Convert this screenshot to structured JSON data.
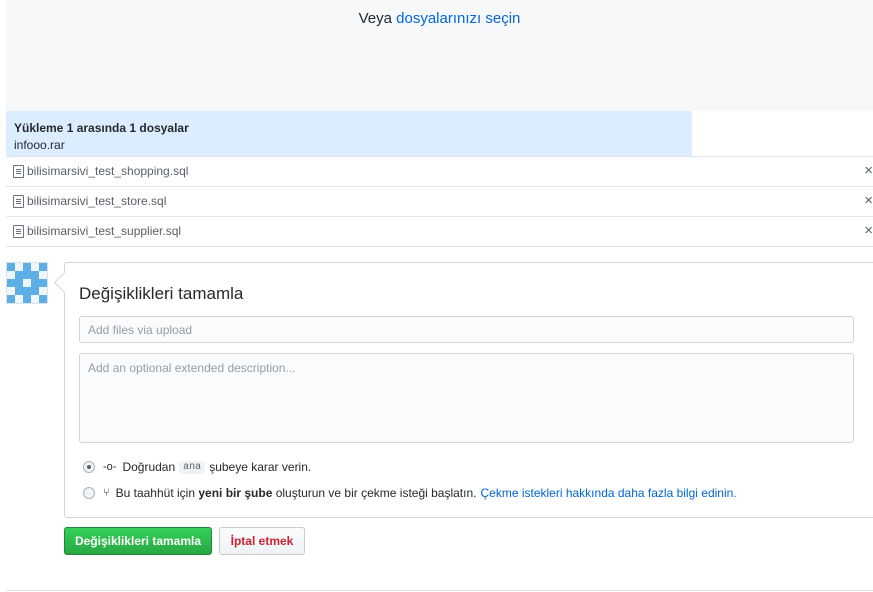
{
  "dropzone": {
    "prefix": "Veya",
    "link": "dosyalarınızı seçin"
  },
  "upload": {
    "status": "Yükleme 1 arasında 1 dosyalar",
    "filename": "infooo.rar"
  },
  "files": [
    {
      "name": "bilisimarsivi_test_shopping.sql",
      "remove_icon": "×"
    },
    {
      "name": "bilisimarsivi_test_store.sql",
      "remove_icon": "×"
    },
    {
      "name": "bilisimarsivi_test_supplier.sql",
      "remove_icon": "×"
    }
  ],
  "commit": {
    "title": "Değişiklikleri tamamla",
    "summary_placeholder": "Add files via upload",
    "description_placeholder": "Add an optional extended description...",
    "option_direct": {
      "before": "Doğrudan",
      "branch": "ana",
      "after": "şubeye karar verin.",
      "selected": true
    },
    "option_new": {
      "before": "Bu taahhüt için",
      "bold": "yeni bir şube",
      "after": "oluşturun ve bir çekme isteği başlatın.",
      "link": "Çekme istekleri hakkında daha fazla bilgi edinin.",
      "selected": false
    }
  },
  "buttons": {
    "commit": "Değişiklikleri tamamla",
    "cancel": "İptal etmek"
  },
  "colors": {
    "link": "#0366d6",
    "primary_button": "#28a745",
    "cancel_text": "#cb2431",
    "upload_bar": "#dbedff"
  },
  "icons": {
    "file": "file-text-icon",
    "remove": "close-icon",
    "commit": "git-commit-icon",
    "pull_request": "git-pull-request-icon",
    "avatar": "identicon-avatar"
  }
}
